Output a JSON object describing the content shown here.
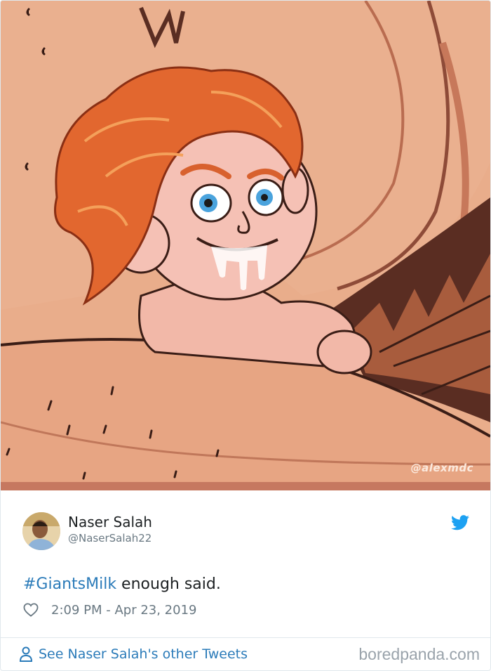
{
  "media": {
    "image_name": "giant-cartoon-illustration",
    "watermark": "@alexmdc"
  },
  "tweet": {
    "author": {
      "name": "Naser Salah",
      "handle": "@NaserSalah22"
    },
    "text": {
      "hashtag": "#GiantsMilk",
      "body": " enough said."
    },
    "timestamp": "2:09 PM - Apr 23, 2019",
    "footer_link": "See Naser Salah's other Tweets"
  },
  "credit": "boredpanda.com",
  "colors": {
    "link": "#2b7bb9",
    "twitter_blue": "#1da1f2",
    "meta_gray": "#697882",
    "text": "#1c2022"
  },
  "icons": {
    "bird": "twitter-bird-icon",
    "heart": "heart-icon",
    "person": "person-icon"
  }
}
